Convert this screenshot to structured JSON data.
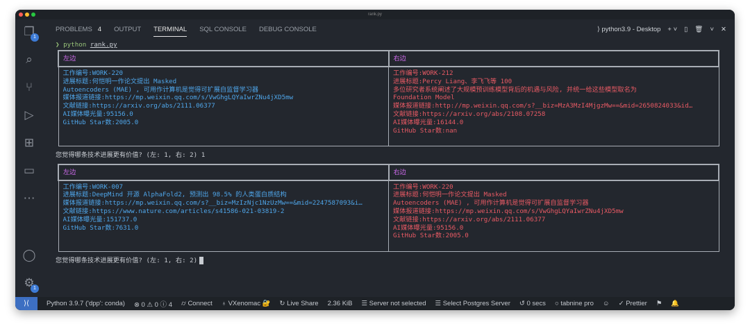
{
  "window": {
    "title": "rank.py"
  },
  "activity": {
    "explorer_badge": "1",
    "settings_badge": "1"
  },
  "panel": {
    "tabs": [
      {
        "label": "PROBLEMS",
        "count": "4"
      },
      {
        "label": "OUTPUT"
      },
      {
        "label": "TERMINAL"
      },
      {
        "label": "SQL CONSOLE"
      },
      {
        "label": "DEBUG CONSOLE"
      }
    ],
    "terminal_name": "python3.9 - Desktop"
  },
  "terminal": {
    "command_prefix": "❯",
    "command_bin": "python",
    "command_arg": "rank.py",
    "rounds": [
      {
        "left_header": "左边",
        "right_header": "右边",
        "left": [
          "工作编号:WORK-220",
          "进展标题:何恺明一作论文提出 Masked",
          "Autoencoders (MAE) , 可用作计算机是觉得可扩展自监督学习器",
          "媒体报道链接:https://mp.weixin.qq.com/s/VwGhgLQYaIwrZNu4jXD5mw",
          "文献链接:https://arxiv.org/abs/2111.06377",
          "AI媒体曝光量:95156.0",
          "GitHub Star数:2005.0"
        ],
        "right": [
          "工作编号:WORK-212",
          "进展标题:Percy Liang、李飞飞等 100",
          "多位研究者系统阐述了大规模预训练模型背后的机遇与风险, 并统一给这些模型取名为",
          "Foundation Model",
          "媒体报道链接:http://mp.weixin.qq.com/s?__biz=MzA3MzI4MjgzMw==&mid=2650824033&id…",
          "文献链接:https://arxiv.org/abs/2108.07258",
          "AI媒体曝光量:16144.0",
          "GitHub Star数:nan"
        ],
        "prompt": "您觉得哪条技术进展更有价值? (左: 1, 右: 2) 1"
      },
      {
        "left_header": "左边",
        "right_header": "右边",
        "left": [
          "工作编号:WORK-007",
          "进展标题:DeepMind 开源 AlphaFold2, 预测出 98.5% 的人类蛋白质结构",
          "媒体报道链接:https://mp.weixin.qq.com/s?__biz=MzIzNjc1NzUzMw==&mid=2247587093&i…",
          "文献链接:https://www.nature.com/articles/s41586-021-03819-2",
          "AI媒体曝光量:151737.0",
          "GitHub Star数:7631.0"
        ],
        "right": [
          "工作编号:WORK-220",
          "进展标题:何恺明一作论文提出 Masked",
          "Autoencoders (MAE) , 可用作计算机是觉得可扩展自监督学习器",
          "媒体报道链接:https://mp.weixin.qq.com/s/VwGhgLQYaIwrZNu4jXD5mw",
          "文献链接:https://arxiv.org/abs/2111.06377",
          "AI媒体曝光量:95156.0",
          "GitHub Star数:2005.0"
        ],
        "prompt": "您觉得哪条技术进展更有价值? (左: 1, 右: 2)"
      }
    ]
  },
  "status": {
    "interpreter": "Python 3.9.7 ('dpp': conda)",
    "problems": "⊗ 0 ⚠ 0 ⓘ 4",
    "connect": "Connect",
    "user": "VXenomac 🔐",
    "live_share": "Live Share",
    "size": "2.36 KiB",
    "server": "Server not selected",
    "postgres": "Select Postgres Server",
    "timer": "0 secs",
    "tabnine": "tabnine pro",
    "prettier": "Prettier"
  }
}
